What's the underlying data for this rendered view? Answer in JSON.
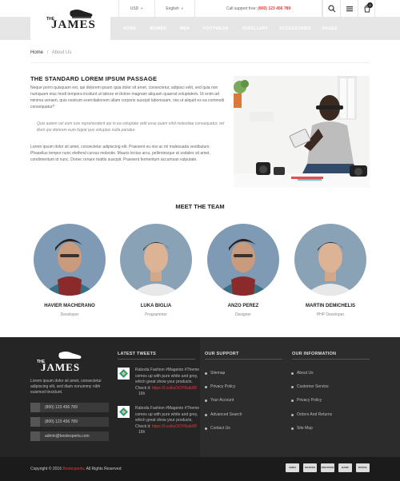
{
  "topbar": {
    "currency": "USD",
    "language": "English",
    "support_label": "Call support free:",
    "support_phone": "(800) 123 456 789",
    "cart_count": "0"
  },
  "logo": {
    "the": "THE",
    "name": "JAMES"
  },
  "nav": [
    "HOME",
    "WOMEN",
    "MEN",
    "FOOTWEAR",
    "JEWELLERY",
    "ACCESSORIES",
    "PAGES"
  ],
  "breadcrumb": {
    "home": "Home",
    "sep": "/",
    "current": "About Us"
  },
  "about": {
    "title": "THE STANDARD LOREM IPSUM PASSAGE",
    "p1": "Neque porro quisquam est, qui dolorem ipsum quia dolor sit amet, consectetur, adipisci velit, sed quia non numquam eius modi tempora incidunt ut labore et dolore magnam aliquam quaerat voluptatem. Ut enim ad minima veniam, quis nostrum exercitationem ullam corporis suscipit laboriosam, nisi ut aliquid ex ea commodi consequatur?",
    "quote": "Quis autem vel eum iure reprehenderit qui in ea voluptate velit esse quam nihil molestiae consequatur, vel illum qui dolorem eum fugiat quo voluptas nulla pariatur.",
    "p2": "Lorem ipsum dolor sit amet, consectetur adipiscing elit. Praesent eu nisi ac mi malesuada vestibulum. Phasellus tempor nunc eleifend cursus molestie. Mauris lectus arcu, pellentesque at sodales sit amet, condimentum id nunc. Donec ornare mattis suscipit. Praesent fermentum accumsan vulputate."
  },
  "team": {
    "title": "MEET THE TEAM",
    "members": [
      {
        "name": "HAVIER MACHERANO",
        "role": "Developer"
      },
      {
        "name": "LUKA BIGLIA",
        "role": "Programmer"
      },
      {
        "name": "ANZO PEREZ",
        "role": "Designer"
      },
      {
        "name": "MARTIN DEMICHELIS",
        "role": "PHP Developer"
      }
    ]
  },
  "footer": {
    "desc": "Lorem ipsum dolor sit amet, consectetur adipiscing elit, sed diam nonummy nibh euismod tincidunt.",
    "phone1": "(800) 123 456 789",
    "phone2": "(800) 123 456 789",
    "email": "admin@bootexperts.com",
    "tweets_title": "LATEST TWEETS",
    "tweets": [
      {
        "text": "Raboda Fashion #Magento #Theme comes up with pure white and grey, which great show your products. Check it:",
        "link": "https://t.co/kzOOY6wbX8",
        "time": "16h"
      },
      {
        "text": "Raboda Fashion #Magento #Theme comes up with pure white and grey, which great show your products. Check it:",
        "link": "https://t.co/kzOOY6wbX8",
        "time": "16h"
      }
    ],
    "support_title": "OUR SUPPORT",
    "support_links": [
      "Sitemap",
      "Privacy Policy",
      "Your Account",
      "Advanced Search",
      "Contact Us"
    ],
    "info_title": "OUR INFORMATION",
    "info_links": [
      "About Us",
      "Customer Service",
      "Privacy Policy",
      "Orders And Returns",
      "Site Map"
    ],
    "copyright_prefix": "Copyright © 2016",
    "copyright_brand": "Bootexperts",
    "copyright_suffix": ". All Rights Reserved",
    "payments": [
      "AMEX",
      "MASTER",
      "DISCOVER",
      "BANK",
      "PAYPAL"
    ]
  },
  "colors": {
    "accent": "#e5393d",
    "nav_bg": "#e6e6e6",
    "footer_bg": "#252525"
  }
}
